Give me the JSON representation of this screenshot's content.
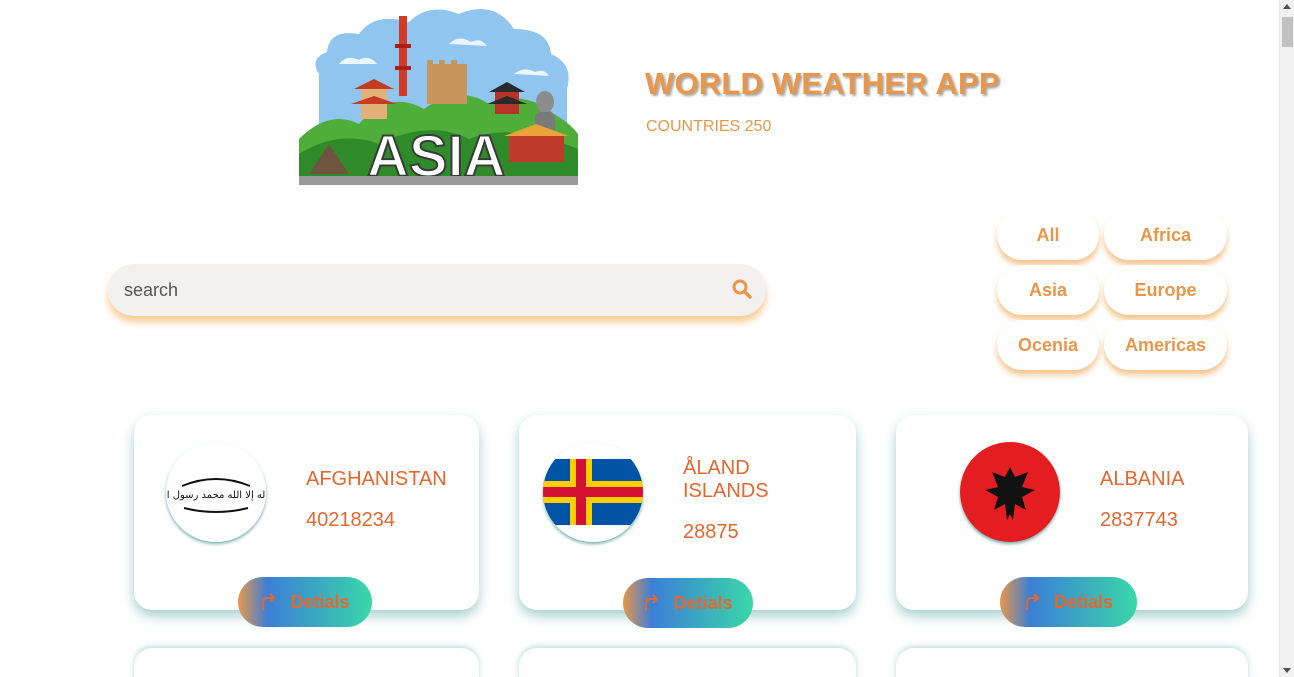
{
  "header": {
    "hero_label": "ASIA",
    "title": "WORLD WEATHER APP",
    "countries_count": "COUNTRIES 250"
  },
  "search": {
    "placeholder": "search",
    "value": "",
    "icon": "search-icon"
  },
  "filters": [
    "All",
    "Africa",
    "Asia",
    "Europe",
    "Ocenia",
    "Americas"
  ],
  "countries": [
    {
      "name": "AFGHANISTAN",
      "population": "40218234",
      "button": "Detials",
      "button_icon": "redo-arrow-icon",
      "flag_text": "لا إله إلا الله محمد رسول الله"
    },
    {
      "name": "ÅLAND ISLANDS",
      "population": "28875",
      "button": "Detials",
      "button_icon": "redo-arrow-icon"
    },
    {
      "name": "ALBANIA",
      "population": "2837743",
      "button": "Detials",
      "button_icon": "redo-arrow-icon"
    }
  ],
  "colors": {
    "accent": "#e8974a",
    "country_text": "#e5672e",
    "button_gradient": [
      "#e8974a",
      "#3c7fd6",
      "#3ad7a8"
    ]
  }
}
